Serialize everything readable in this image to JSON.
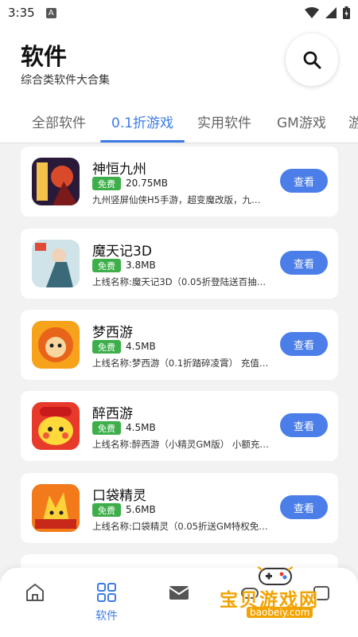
{
  "status_bar": {
    "time": "3:35",
    "notif_letter": "A"
  },
  "header": {
    "title": "软件",
    "subtitle": "综合类软件大合集"
  },
  "tabs": [
    {
      "label": "全部软件"
    },
    {
      "label": "0.1折游戏"
    },
    {
      "label": "实用软件"
    },
    {
      "label": "GM游戏"
    },
    {
      "label": "游"
    }
  ],
  "apps": [
    {
      "name": "神恒九州",
      "badge": "免费",
      "size": "20.75MB",
      "desc": "九州竖屏仙侠H5手游，超变魔改版，九…",
      "button": "查看"
    },
    {
      "name": "魔天记3D",
      "badge": "免费",
      "size": "3.8MB",
      "desc": "上线名称:魔天记3D（0.05折登陆送百抽…",
      "button": "查看"
    },
    {
      "name": "梦西游",
      "badge": "免费",
      "size": "4.5MB",
      "desc": "上线名称:梦西游（0.1折踏碎凌霄） 充值…",
      "button": "查看"
    },
    {
      "name": "醉西游",
      "badge": "免费",
      "size": "4.5MB",
      "desc": "上线名称:醉西游（小精灵GM版） 小额充…",
      "button": "查看"
    },
    {
      "name": "口袋精灵",
      "badge": "免费",
      "size": "5.6MB",
      "desc": "上线名称:口袋精灵（0.05折送GM特权免…",
      "button": "查看"
    }
  ],
  "bottom_nav": {
    "active_label": "软件"
  },
  "watermark": {
    "text": "宝贝游戏网",
    "url": "baobeiy.com"
  },
  "colors": {
    "accent": "#3c7be6",
    "button": "#4b7ee8",
    "free": "#3dae4a",
    "watermark": "#f2a300"
  }
}
